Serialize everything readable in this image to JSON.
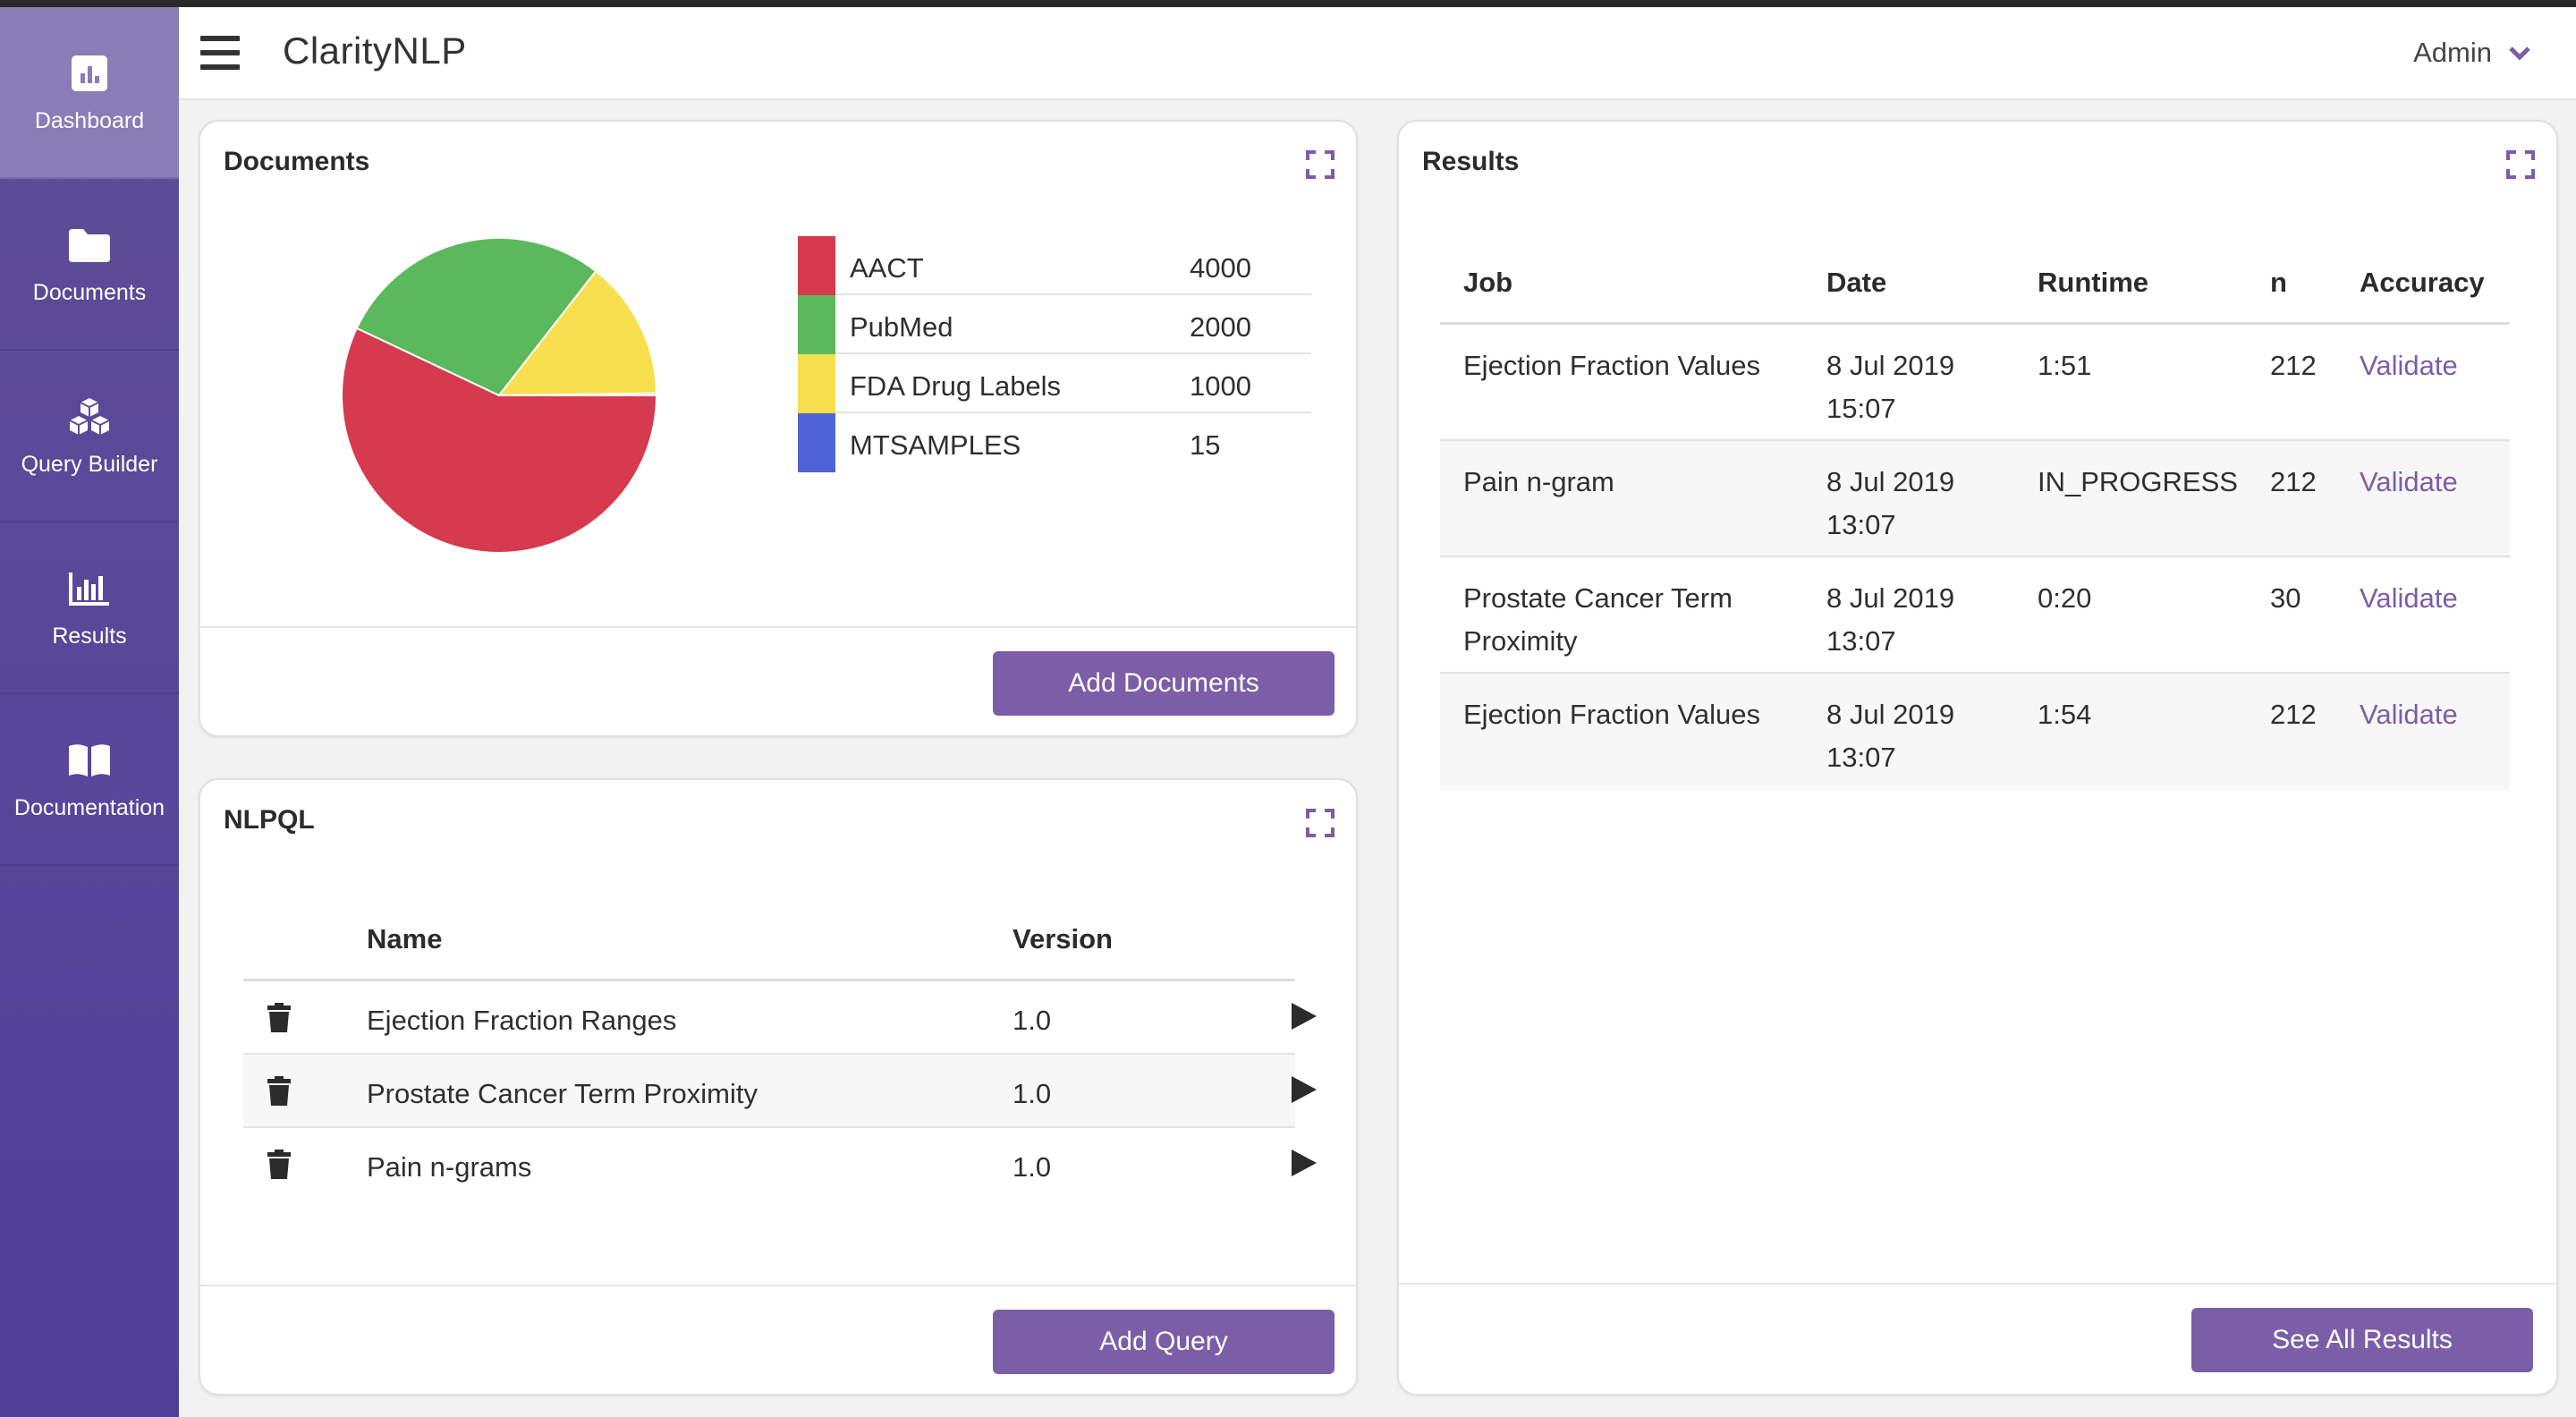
{
  "app": {
    "title": "ClarityNLP",
    "user": "Admin"
  },
  "sidebar": {
    "items": [
      {
        "label": "Dashboard",
        "icon": "bar-chart-icon"
      },
      {
        "label": "Documents",
        "icon": "folder-icon"
      },
      {
        "label": "Query Builder",
        "icon": "cubes-icon"
      },
      {
        "label": "Results",
        "icon": "chart-icon"
      },
      {
        "label": "Documentation",
        "icon": "book-icon"
      }
    ]
  },
  "documents": {
    "title": "Documents",
    "button": "Add Documents",
    "legend": [
      {
        "name": "AACT",
        "value": "4000",
        "color": "#d63a4f"
      },
      {
        "name": "PubMed",
        "value": "2000",
        "color": "#5cb85c"
      },
      {
        "name": "FDA Drug Labels",
        "value": "1000",
        "color": "#f8df4e"
      },
      {
        "name": "MTSAMPLES",
        "value": "15",
        "color": "#4d63d6"
      }
    ]
  },
  "chart_data": {
    "type": "pie",
    "categories": [
      "AACT",
      "PubMed",
      "FDA Drug Labels",
      "MTSAMPLES"
    ],
    "values": [
      4000,
      2000,
      1000,
      15
    ],
    "colors": [
      "#d63a4f",
      "#5cb85c",
      "#f8df4e",
      "#4d63d6"
    ]
  },
  "nlpql": {
    "title": "NLPQL",
    "headers": {
      "name": "Name",
      "version": "Version"
    },
    "rows": [
      {
        "name": "Ejection Fraction Ranges",
        "version": "1.0"
      },
      {
        "name": "Prostate Cancer Term Proximity",
        "version": "1.0"
      },
      {
        "name": "Pain n-grams",
        "version": "1.0"
      }
    ],
    "button": "Add Query"
  },
  "results": {
    "title": "Results",
    "headers": {
      "job": "Job",
      "date": "Date",
      "runtime": "Runtime",
      "n": "n",
      "accuracy": "Accuracy"
    },
    "rows": [
      {
        "job_l1": "Ejection Fraction Values",
        "job_l2": "",
        "date_l1": "8 Jul 2019",
        "date_l2": "15:07",
        "runtime": "1:51",
        "n": "212",
        "accuracy": "Validate"
      },
      {
        "job_l1": "Pain n-gram",
        "job_l2": "",
        "date_l1": "8 Jul 2019",
        "date_l2": "13:07",
        "runtime": "IN_PROGRESS",
        "n": "212",
        "accuracy": "Validate"
      },
      {
        "job_l1": "Prostate Cancer Term",
        "job_l2": "Proximity",
        "date_l1": "8 Jul 2019",
        "date_l2": "13:07",
        "runtime": "0:20",
        "n": "30",
        "accuracy": "Validate"
      },
      {
        "job_l1": "Ejection Fraction Values",
        "job_l2": "",
        "date_l1": "8 Jul 2019",
        "date_l2": "13:07",
        "runtime": "1:54",
        "n": "212",
        "accuracy": "Validate"
      }
    ],
    "button": "See All Results"
  }
}
